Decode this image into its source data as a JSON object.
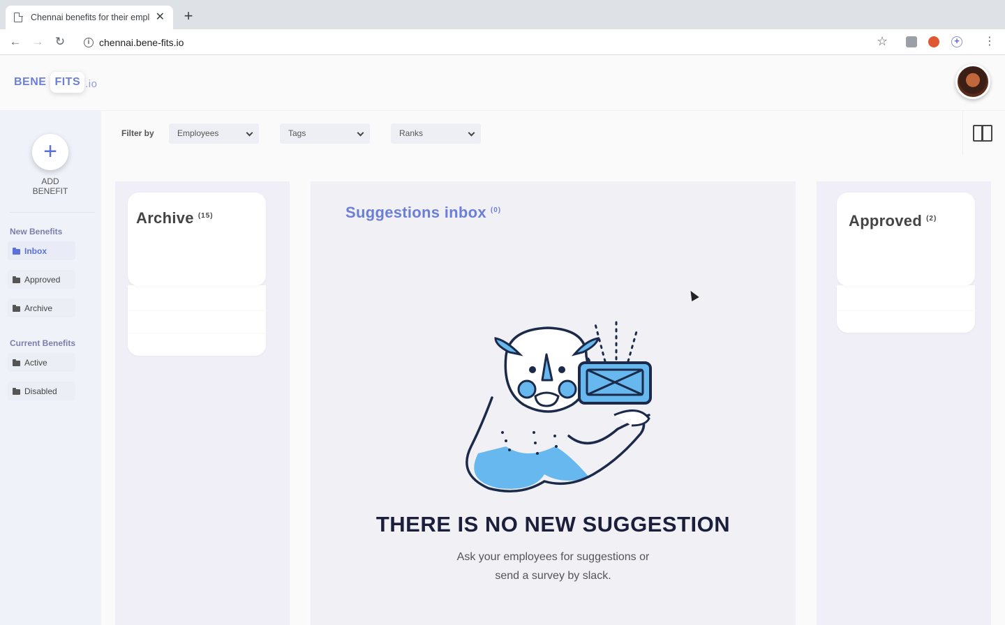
{
  "browser": {
    "tab_title": "Chennai benefits for their empl...",
    "url": "chennai.bene-fits.io"
  },
  "header": {
    "logo_part1": "BENE",
    "logo_part2": "FITS",
    "logo_part3": ".io"
  },
  "sidebar": {
    "add_label_line1": "ADD",
    "add_label_line2": "BENEFIT",
    "section_new": "New Benefits",
    "section_current": "Current Benefits",
    "items": [
      {
        "label": "Inbox"
      },
      {
        "label": "Approved"
      },
      {
        "label": "Archive"
      },
      {
        "label": "Active"
      },
      {
        "label": "Disabled"
      }
    ]
  },
  "filters": {
    "label": "Filter by",
    "employees": "Employees",
    "tags": "Tags",
    "ranks": "Ranks"
  },
  "columns": {
    "archive": {
      "title": "Archive",
      "count": "(15)"
    },
    "inbox": {
      "title": "Suggestions inbox",
      "count": "(0)"
    },
    "approved": {
      "title": "Approved",
      "count": "(2)"
    }
  },
  "empty_state": {
    "title": "THERE IS NO NEW SUGGESTION",
    "line1": "Ask your employees for suggestions or",
    "line2": "send a survey by slack."
  },
  "colors": {
    "accent": "#6b7fd7",
    "sidebar_bg": "#f0f2fa",
    "illustration_blue": "#66b8ee",
    "illustration_dark": "#1c2a4a"
  },
  "icons": [
    "doc-icon",
    "close-icon",
    "plus-icon",
    "back-icon",
    "forward-icon",
    "reload-icon",
    "info-icon",
    "star-icon",
    "folder-icon",
    "chevron-down-icon",
    "split-view-icon"
  ]
}
